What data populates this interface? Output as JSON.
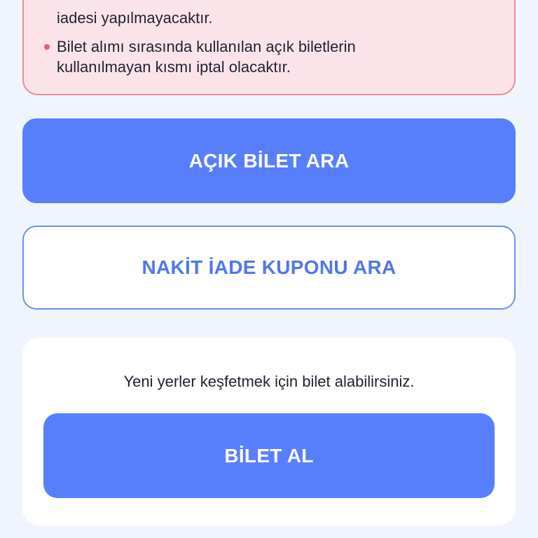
{
  "notice": {
    "lines": [
      "iadesi yapılmayacaktır.",
      "Bilet alımı sırasında kullanılan açık biletlerin",
      "kullanılmayan kısmı iptal olacaktır."
    ]
  },
  "buttons": {
    "open_ticket_search": "AÇIK BİLET ARA",
    "cash_refund_coupon_search": "NAKİT İADE KUPONU ARA"
  },
  "buy_card": {
    "message": "Yeni yerler keşfetmek için bilet alabilirsiniz.",
    "buy_button": "BİLET AL"
  },
  "colors": {
    "primary": "#577ffd",
    "notice_bg": "#fbe3ea",
    "notice_border": "#ef8a9c",
    "bullet": "#ee5a74",
    "page_bg": "#f0f5fd"
  }
}
